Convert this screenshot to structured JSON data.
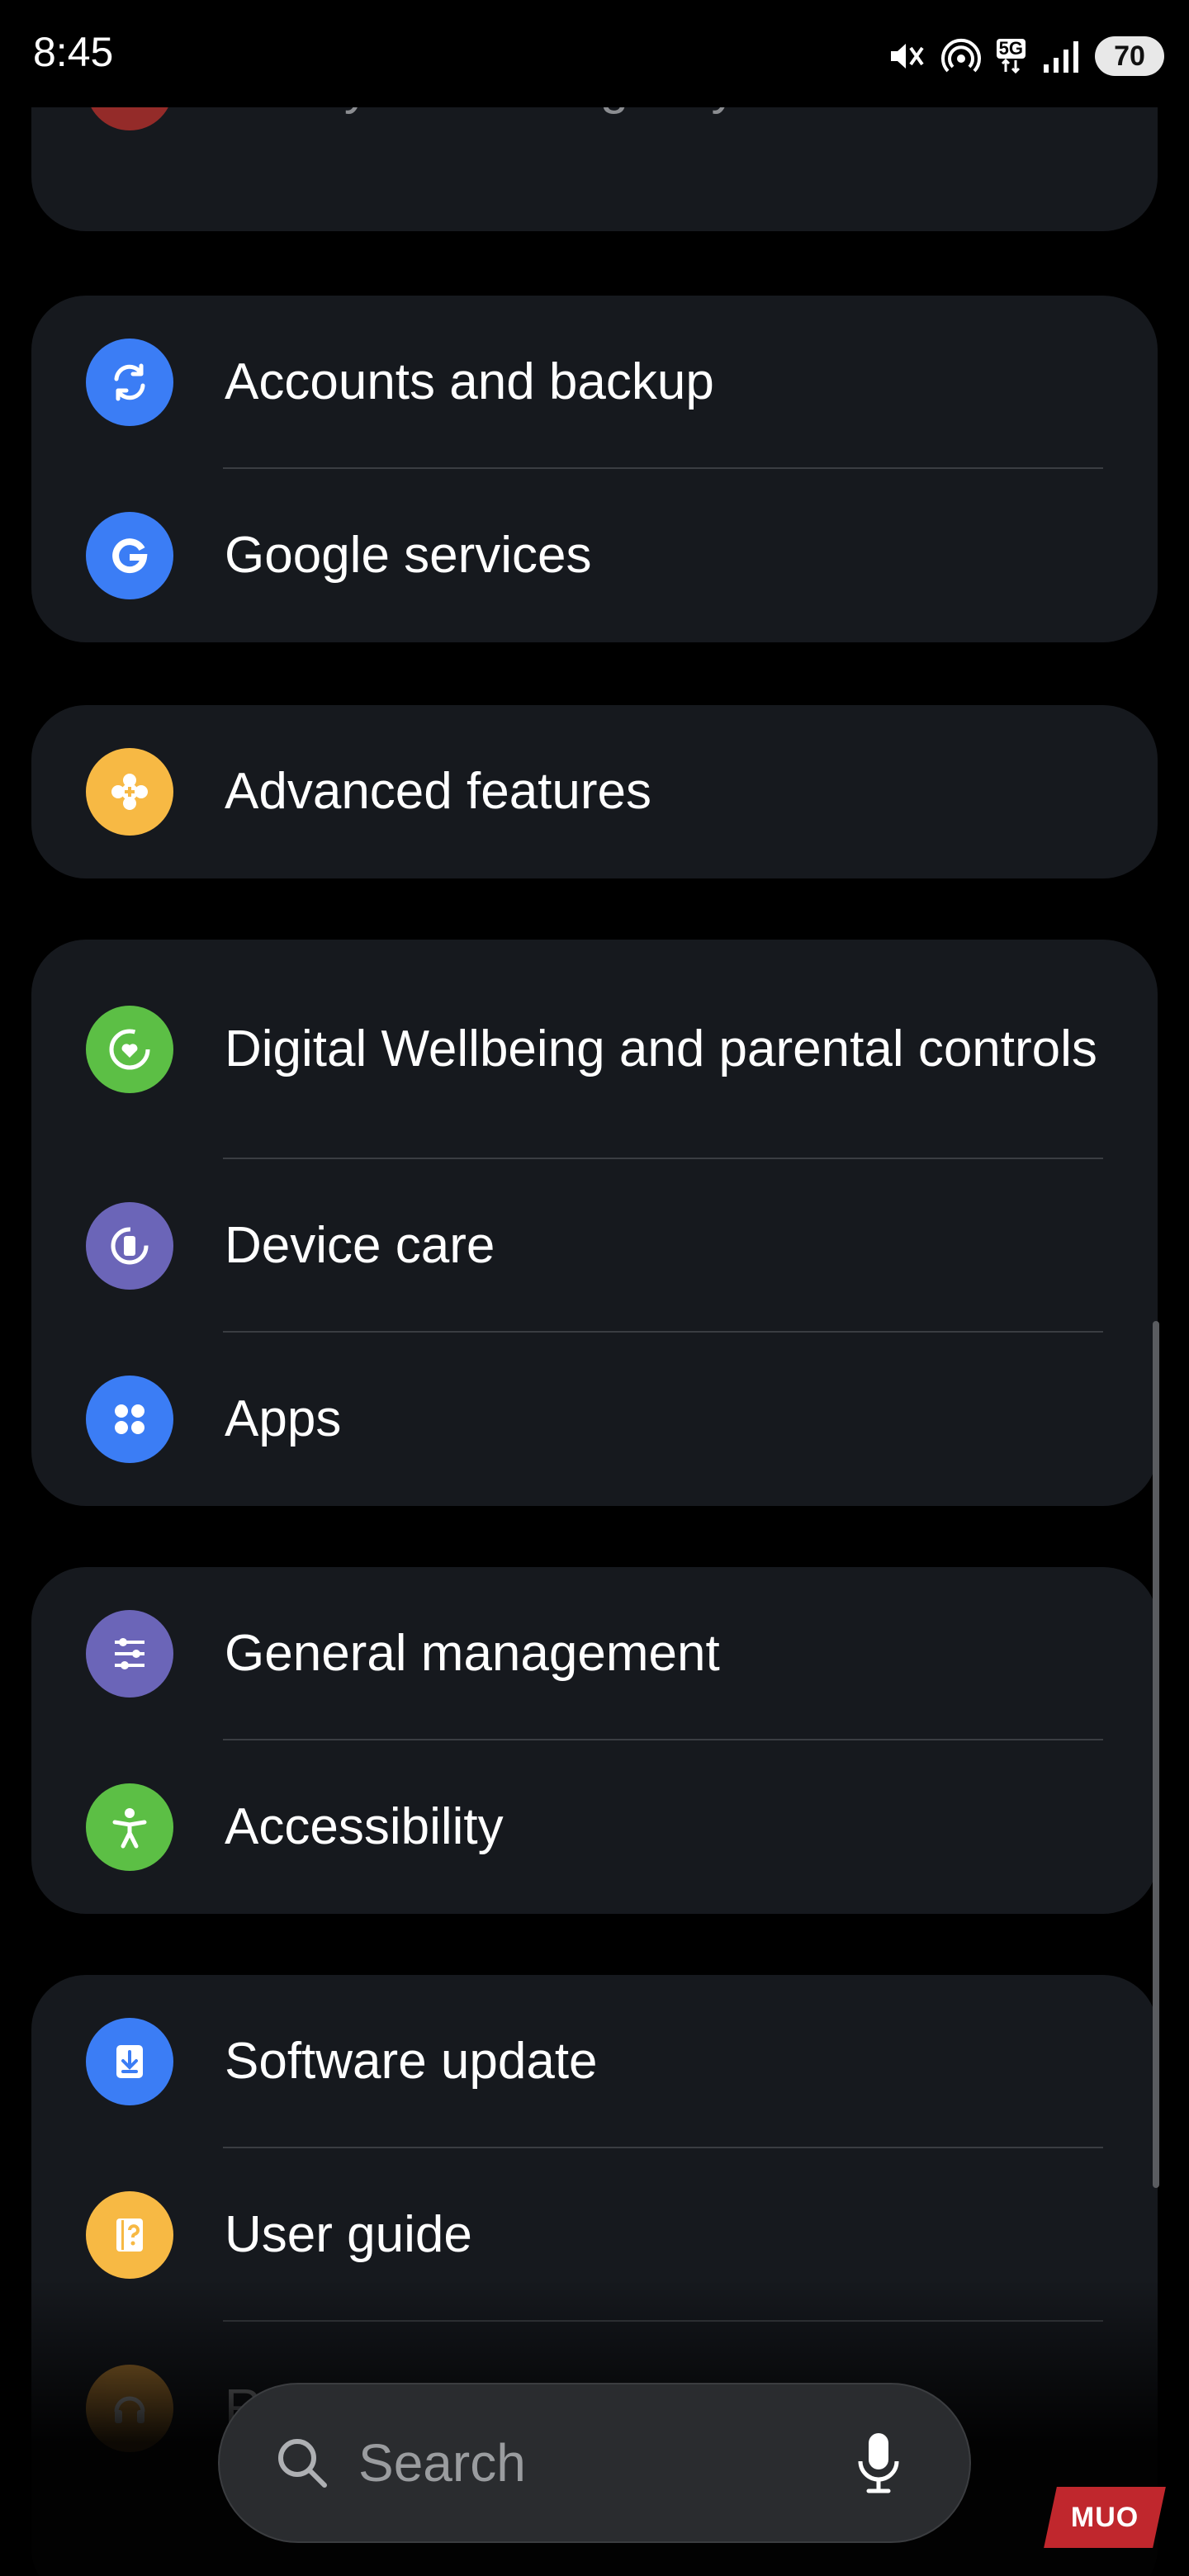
{
  "status_bar": {
    "time": "8:45",
    "network": "5G",
    "battery": "70"
  },
  "groups": [
    {
      "items": [
        {
          "label": "Safety and emergency",
          "icon": "siren-icon",
          "color": "#d9362f"
        }
      ]
    },
    {
      "items": [
        {
          "label": "Accounts and backup",
          "icon": "sync-icon",
          "color": "#3b7df5"
        },
        {
          "label": "Google services",
          "icon": "google-icon",
          "color": "#3b7df5"
        }
      ]
    },
    {
      "items": [
        {
          "label": "Advanced features",
          "icon": "gear-puzzle-icon",
          "color": "#f7b944"
        }
      ]
    },
    {
      "items": [
        {
          "label": "Digital Wellbeing and parental controls",
          "icon": "heart-circle-icon",
          "color": "#5cbf45"
        },
        {
          "label": "Device care",
          "icon": "device-care-icon",
          "color": "#6b65b8"
        },
        {
          "label": "Apps",
          "icon": "apps-grid-icon",
          "color": "#3b7df5"
        }
      ]
    },
    {
      "items": [
        {
          "label": "General management",
          "icon": "sliders-icon",
          "color": "#6b65b8"
        },
        {
          "label": "Accessibility",
          "icon": "accessibility-icon",
          "color": "#5cbf45"
        }
      ]
    },
    {
      "items": [
        {
          "label": "Software update",
          "icon": "download-icon",
          "color": "#3b7df5"
        },
        {
          "label": "User guide",
          "icon": "book-question-icon",
          "color": "#f7b944"
        },
        {
          "label": "R",
          "icon": "headset-icon",
          "color": "#f0a53a"
        }
      ]
    }
  ],
  "search": {
    "placeholder": "Search"
  },
  "watermark": "MUO"
}
